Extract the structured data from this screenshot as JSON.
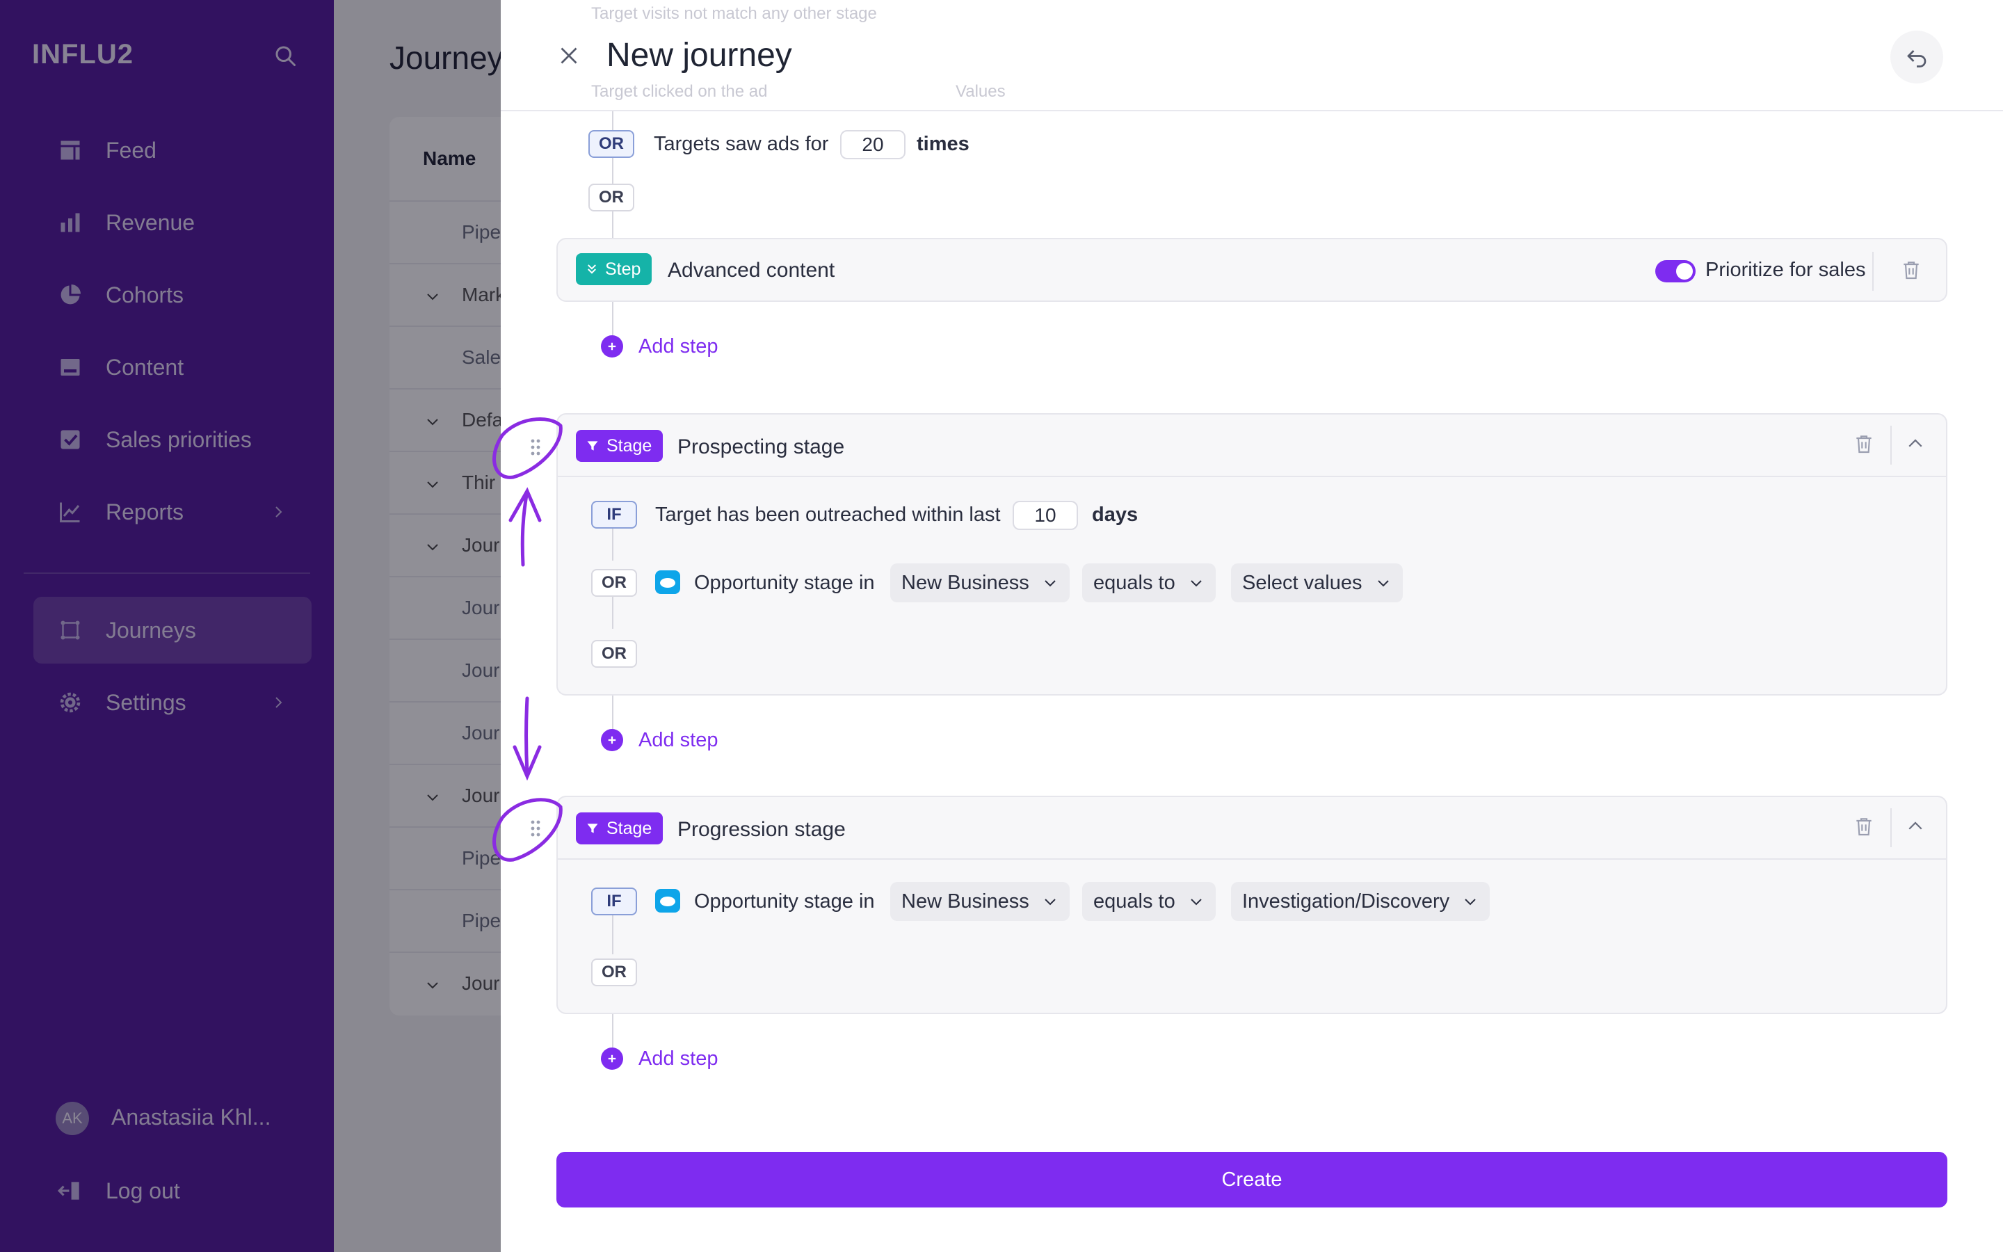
{
  "sidebar": {
    "logo": "INFLU2",
    "nav": [
      {
        "label": "Feed",
        "icon": "feed-icon"
      },
      {
        "label": "Revenue",
        "icon": "bar-chart-icon"
      },
      {
        "label": "Cohorts",
        "icon": "pie-chart-icon"
      },
      {
        "label": "Content",
        "icon": "content-icon"
      },
      {
        "label": "Sales priorities",
        "icon": "checkbox-icon"
      },
      {
        "label": "Reports",
        "icon": "line-chart-icon"
      },
      {
        "label": "Journeys",
        "icon": "journeys-icon",
        "active": true
      },
      {
        "label": "Settings",
        "icon": "gear-icon"
      }
    ],
    "user": {
      "initials": "AK",
      "name": "Anastasiia Khl..."
    },
    "logout_label": "Log out"
  },
  "background_page": {
    "title": "Journey",
    "table_header": "Name",
    "rows": [
      "Pipe",
      "Mark",
      "Sale",
      "Defa",
      "Thir",
      "Jour",
      "Jour",
      "Jour",
      "Jour",
      "Jour",
      "Pipe",
      "Pipe",
      "Jour"
    ]
  },
  "modal": {
    "title": "New journey",
    "ghost_rows": [
      "Target visits not match any other stage",
      "Target clicked on the ad",
      "Values"
    ],
    "top_condition": {
      "chip": "OR",
      "text": "Targets saw ads for",
      "value": "20",
      "unit": "times"
    },
    "or_chip": "OR",
    "step_card": {
      "badge": "Step",
      "title": "Advanced content",
      "toggle_label": "Prioritize for sales",
      "toggle_on": true
    },
    "add_step_label": "Add step",
    "prospecting": {
      "badge": "Stage",
      "title": "Prospecting stage",
      "if_chip": "IF",
      "if_text": "Target has been outreached within last",
      "if_value": "10",
      "if_unit": "days",
      "or_chip": "OR",
      "or_text": "Opportunity stage in",
      "dd1": "New Business",
      "dd2": "equals to",
      "dd3": "Select values",
      "or_chip2": "OR"
    },
    "progression": {
      "badge": "Stage",
      "title": "Progression stage",
      "if_chip": "IF",
      "if_text": "Opportunity stage in",
      "dd1": "New Business",
      "dd2": "equals to",
      "dd3": "Investigation/Discovery",
      "or_chip": "OR"
    },
    "create_label": "Create"
  },
  "colors": {
    "sidebar": "#541c9d",
    "accent": "#7e2cf0",
    "step": "#15b3a8",
    "salesforce": "#0ea5e9"
  }
}
